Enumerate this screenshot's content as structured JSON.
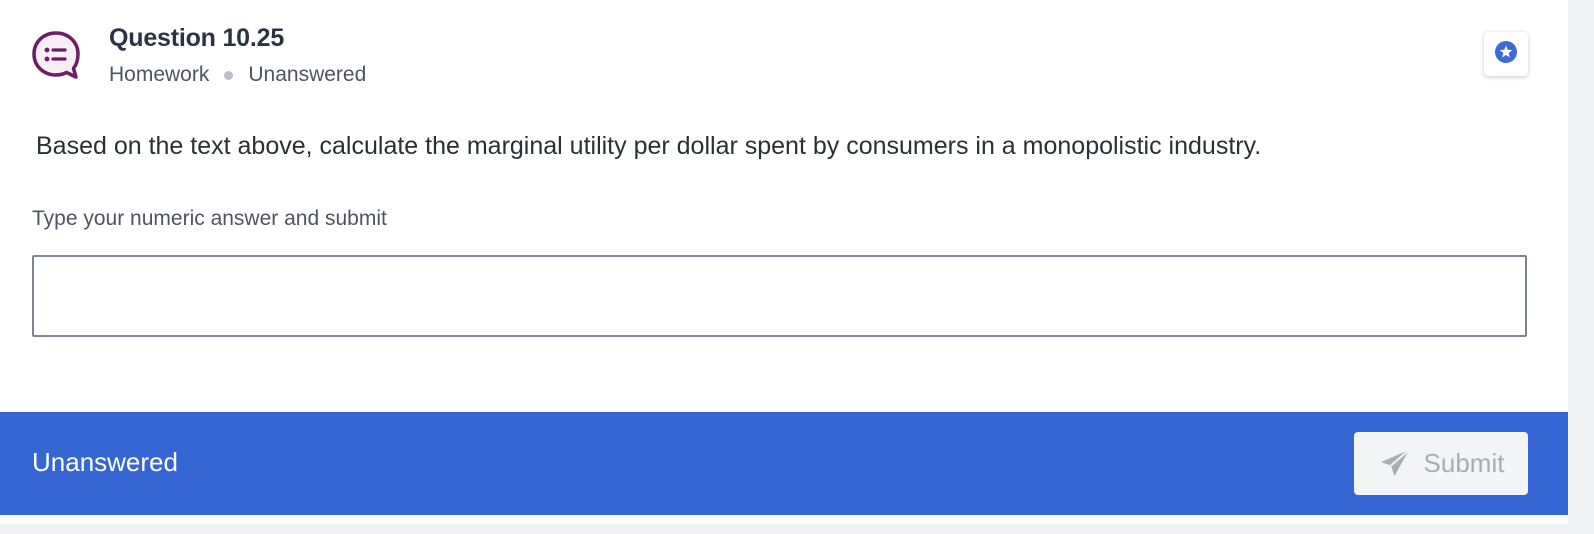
{
  "header": {
    "title": "Question 10.25",
    "category": "Homework",
    "status": "Unanswered"
  },
  "question": {
    "prompt": "Based on the text above, calculate the marginal utility per dollar spent by consumers in a monopolistic industry."
  },
  "answer": {
    "instructions": "Type your numeric answer and submit",
    "value": "",
    "placeholder": ""
  },
  "footer": {
    "status": "Unanswered",
    "submit_label": "Submit"
  },
  "icons": {
    "question": "question-bubble-icon",
    "bookmark": "star-icon",
    "submit": "send-icon"
  },
  "colors": {
    "accent": "#3566d3",
    "icon_purple": "#6b1e62",
    "star_blue": "#3d6bd6"
  }
}
